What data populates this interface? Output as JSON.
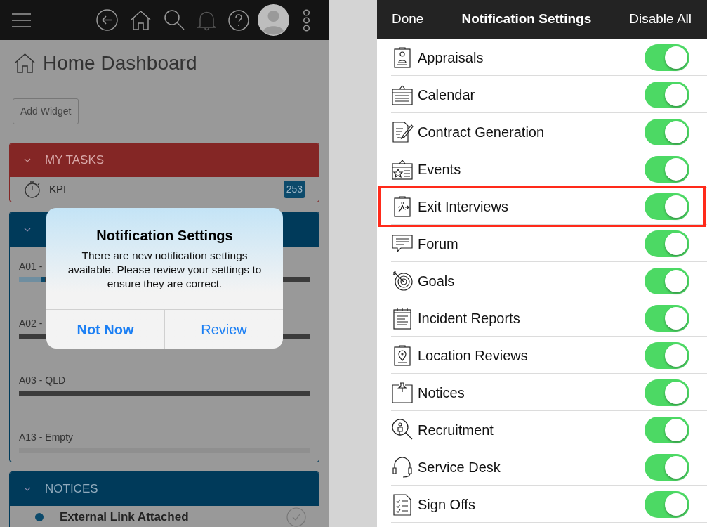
{
  "dashboard": {
    "title": "Home Dashboard",
    "add_widget": "Add Widget",
    "my_tasks": {
      "title": "MY TASKS",
      "items": [
        {
          "label": "KPI",
          "count": "253"
        }
      ]
    },
    "progress_rows": [
      {
        "label": "A01 -",
        "level": 0.09,
        "empty": false
      },
      {
        "label": "A02 -",
        "empty": false
      },
      {
        "label": "A03 - QLD",
        "empty": false
      },
      {
        "label": "A13 - Empty",
        "empty": true
      }
    ],
    "notices": {
      "title": "NOTICES",
      "items": [
        {
          "title": "External Link Attached"
        }
      ]
    }
  },
  "alert": {
    "title": "Notification Settings",
    "message": "There are new notification settings available. Please review your settings to ensure they are correct.",
    "buttons": [
      {
        "label": "Not Now",
        "default": true
      },
      {
        "label": "Review",
        "default": false
      }
    ]
  },
  "settings": {
    "done": "Done",
    "title": "Notification Settings",
    "disable_all": "Disable All",
    "items": [
      {
        "label": "Appraisals",
        "on": true,
        "highlighted": false
      },
      {
        "label": "Calendar",
        "on": true,
        "highlighted": false
      },
      {
        "label": "Contract Generation",
        "on": true,
        "highlighted": false
      },
      {
        "label": "Events",
        "on": true,
        "highlighted": false
      },
      {
        "label": "Exit Interviews",
        "on": true,
        "highlighted": true
      },
      {
        "label": "Forum",
        "on": true,
        "highlighted": false
      },
      {
        "label": "Goals",
        "on": true,
        "highlighted": false
      },
      {
        "label": "Incident Reports",
        "on": true,
        "highlighted": false
      },
      {
        "label": "Location Reviews",
        "on": true,
        "highlighted": false
      },
      {
        "label": "Notices",
        "on": true,
        "highlighted": false
      },
      {
        "label": "Recruitment",
        "on": true,
        "highlighted": false
      },
      {
        "label": "Service Desk",
        "on": true,
        "highlighted": false
      },
      {
        "label": "Sign Offs",
        "on": true,
        "highlighted": false
      }
    ]
  }
}
